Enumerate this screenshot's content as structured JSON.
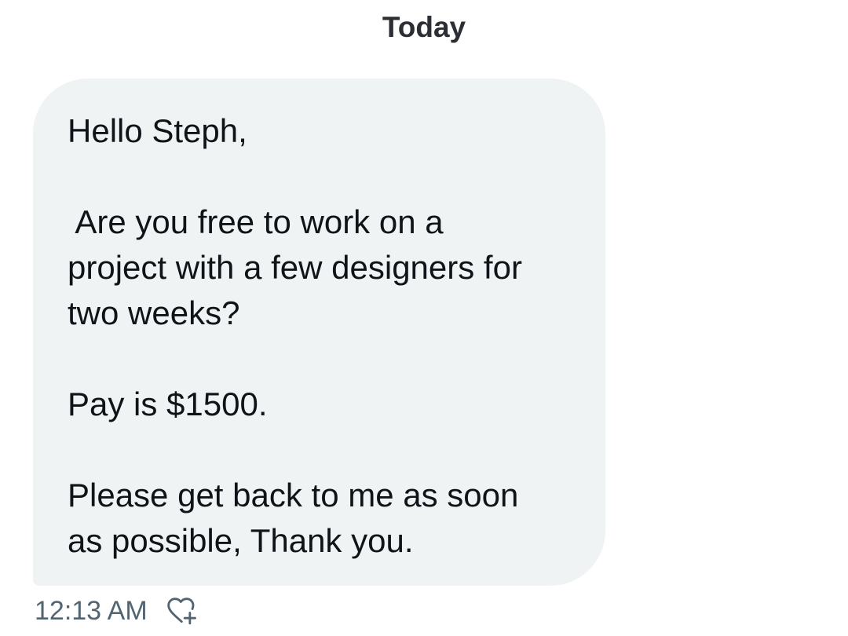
{
  "conversation": {
    "date_separator": "Today",
    "message": {
      "lines": [
        "Hello Steph,",
        "",
        " Are you free to work on a",
        "project with a few designers for",
        "two weeks?",
        "",
        "Pay is $1500.",
        "",
        "Please get back to me as soon",
        "as possible, Thank you."
      ],
      "timestamp": "12:13 AM",
      "reaction_icon": "heart-plus-icon"
    }
  },
  "colors": {
    "bubble_background": "#eff3f4",
    "message_text": "#0f1419",
    "timestamp_text": "#536471",
    "date_text": "#2b2f33"
  }
}
